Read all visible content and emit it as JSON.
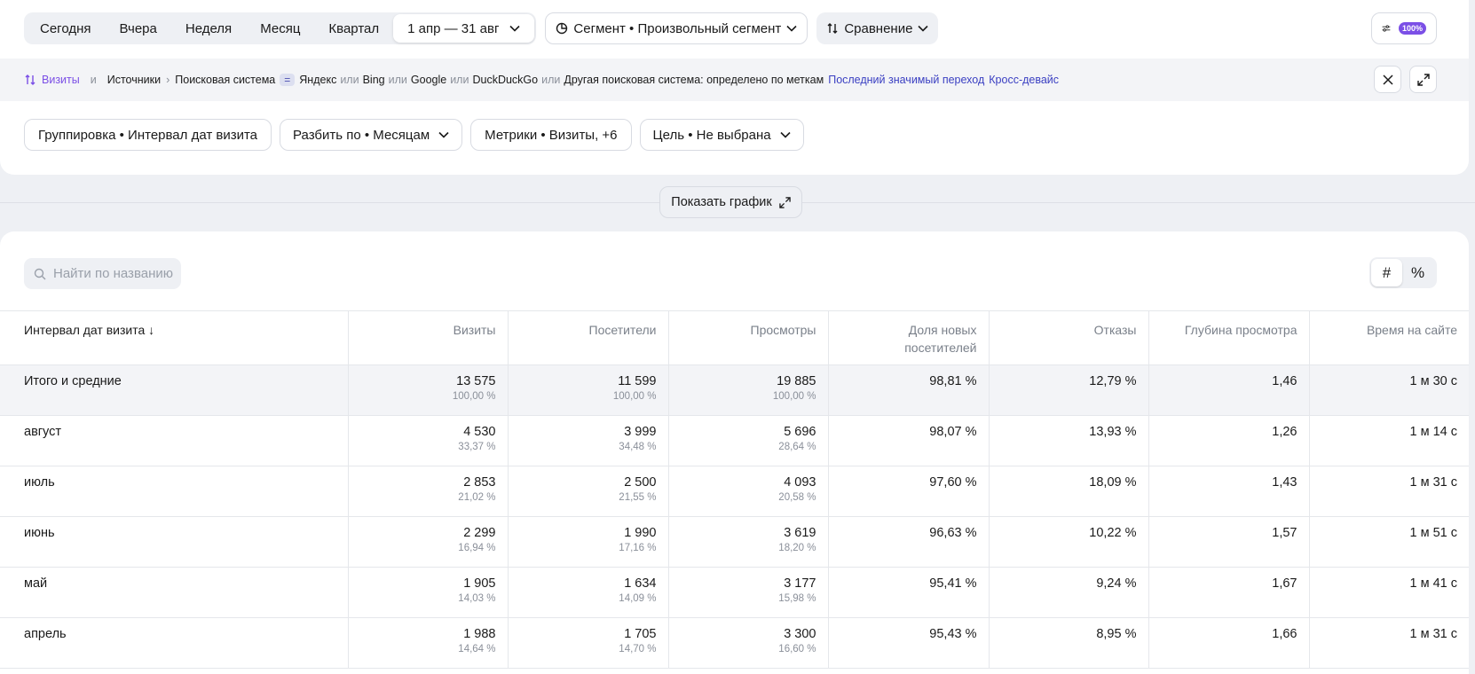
{
  "period": {
    "options": [
      "Сегодня",
      "Вчера",
      "Неделя",
      "Месяц",
      "Квартал"
    ],
    "date_range": "1 апр — 31 авг"
  },
  "segment_label": "Сегмент • Произвольный сегмент",
  "compare_label": "Сравнение",
  "zoom_badge": "100%",
  "filter": {
    "metric": "Визиты",
    "and": "и",
    "source": "Источники",
    "dimension": "Поисковая система",
    "eq": "=",
    "values": [
      "Яндекс",
      "Bing",
      "Google",
      "DuckDuckGo",
      "Другая поисковая система: определено по меткам"
    ],
    "or": "или",
    "link1": "Последний значимый переход",
    "link2": "Кросс-девайс"
  },
  "settings_bar": {
    "grouping": "Группировка • Интервал дат визита",
    "split": "Разбить по • Месяцам",
    "metrics": "Метрики • Визиты, +6",
    "goal": "Цель • Не выбрана"
  },
  "show_chart_label": "Показать график",
  "search_placeholder": "Найти по названию",
  "toggle": {
    "count": "#",
    "percent": "%"
  },
  "table": {
    "headers": [
      "Интервал дат визита ↓",
      "Визиты",
      "Посетители",
      "Просмотры",
      "Доля новых посетителей",
      "Отказы",
      "Глубина просмотра",
      "Время на сайте"
    ],
    "rows": [
      {
        "label": "Итого и средние",
        "visits": "13 575",
        "visits_pct": "100,00 %",
        "visitors": "11 599",
        "visitors_pct": "100,00 %",
        "views": "19 885",
        "views_pct": "100,00 %",
        "new_share": "98,81 %",
        "bounce": "12,79 %",
        "depth": "1,46",
        "time": "1 м 30 с"
      },
      {
        "label": "август",
        "visits": "4 530",
        "visits_pct": "33,37 %",
        "visitors": "3 999",
        "visitors_pct": "34,48 %",
        "views": "5 696",
        "views_pct": "28,64 %",
        "new_share": "98,07 %",
        "bounce": "13,93 %",
        "depth": "1,26",
        "time": "1 м 14 с"
      },
      {
        "label": "июль",
        "visits": "2 853",
        "visits_pct": "21,02 %",
        "visitors": "2 500",
        "visitors_pct": "21,55 %",
        "views": "4 093",
        "views_pct": "20,58 %",
        "new_share": "97,60 %",
        "bounce": "18,09 %",
        "depth": "1,43",
        "time": "1 м 31 с"
      },
      {
        "label": "июнь",
        "visits": "2 299",
        "visits_pct": "16,94 %",
        "visitors": "1 990",
        "visitors_pct": "17,16 %",
        "views": "3 619",
        "views_pct": "18,20 %",
        "new_share": "96,63 %",
        "bounce": "10,22 %",
        "depth": "1,57",
        "time": "1 м 51 с"
      },
      {
        "label": "май",
        "visits": "1 905",
        "visits_pct": "14,03 %",
        "visitors": "1 634",
        "visitors_pct": "14,09 %",
        "views": "3 177",
        "views_pct": "15,98 %",
        "new_share": "95,41 %",
        "bounce": "9,24 %",
        "depth": "1,67",
        "time": "1 м 41 с"
      },
      {
        "label": "апрель",
        "visits": "1 988",
        "visits_pct": "14,64 %",
        "visitors": "1 705",
        "visitors_pct": "14,70 %",
        "views": "3 300",
        "views_pct": "16,60 %",
        "new_share": "95,43 %",
        "bounce": "8,95 %",
        "depth": "1,66",
        "time": "1 м 31 с"
      }
    ]
  },
  "colors": {
    "accent": "#7b4fe6",
    "link": "#3a3fc2",
    "background": "#eef0f4"
  }
}
